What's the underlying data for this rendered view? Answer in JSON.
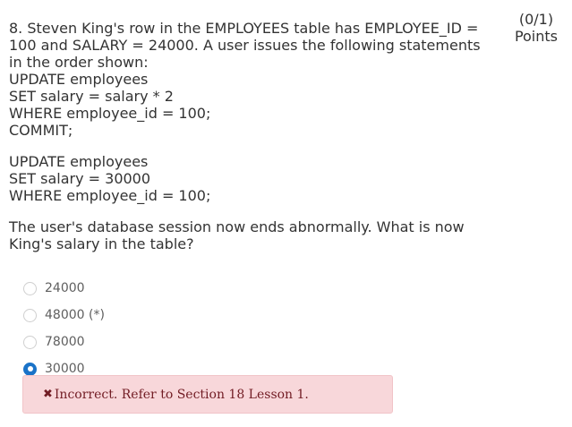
{
  "question": {
    "intro": "8. Steven King's row in the EMPLOYEES table has EMPLOYEE_ID = 100 and SALARY = 24000. A user issues the following statements in the order shown:",
    "sql_block_1": [
      "UPDATE employees",
      "SET salary = salary * 2",
      "WHERE employee_id = 100;",
      "COMMIT;"
    ],
    "sql_block_2": [
      "UPDATE employees",
      "SET salary = 30000",
      "WHERE employee_id = 100;"
    ],
    "prompt": "The user's database session now ends abnormally. What is now King's salary in the table?"
  },
  "points": {
    "score": "(0/1)",
    "label": "Points"
  },
  "options": [
    {
      "label": "24000",
      "selected": false
    },
    {
      "label": "48000 (*)",
      "selected": false
    },
    {
      "label": "78000",
      "selected": false
    },
    {
      "label": "30000",
      "selected": true
    }
  ],
  "feedback": {
    "icon": "x-mark-icon",
    "text": "Incorrect. Refer to Section 18 Lesson 1.",
    "colors": {
      "background": "#f8d7da",
      "text": "#721c24"
    }
  },
  "colors": {
    "selected_radio": "#1a73c8"
  }
}
